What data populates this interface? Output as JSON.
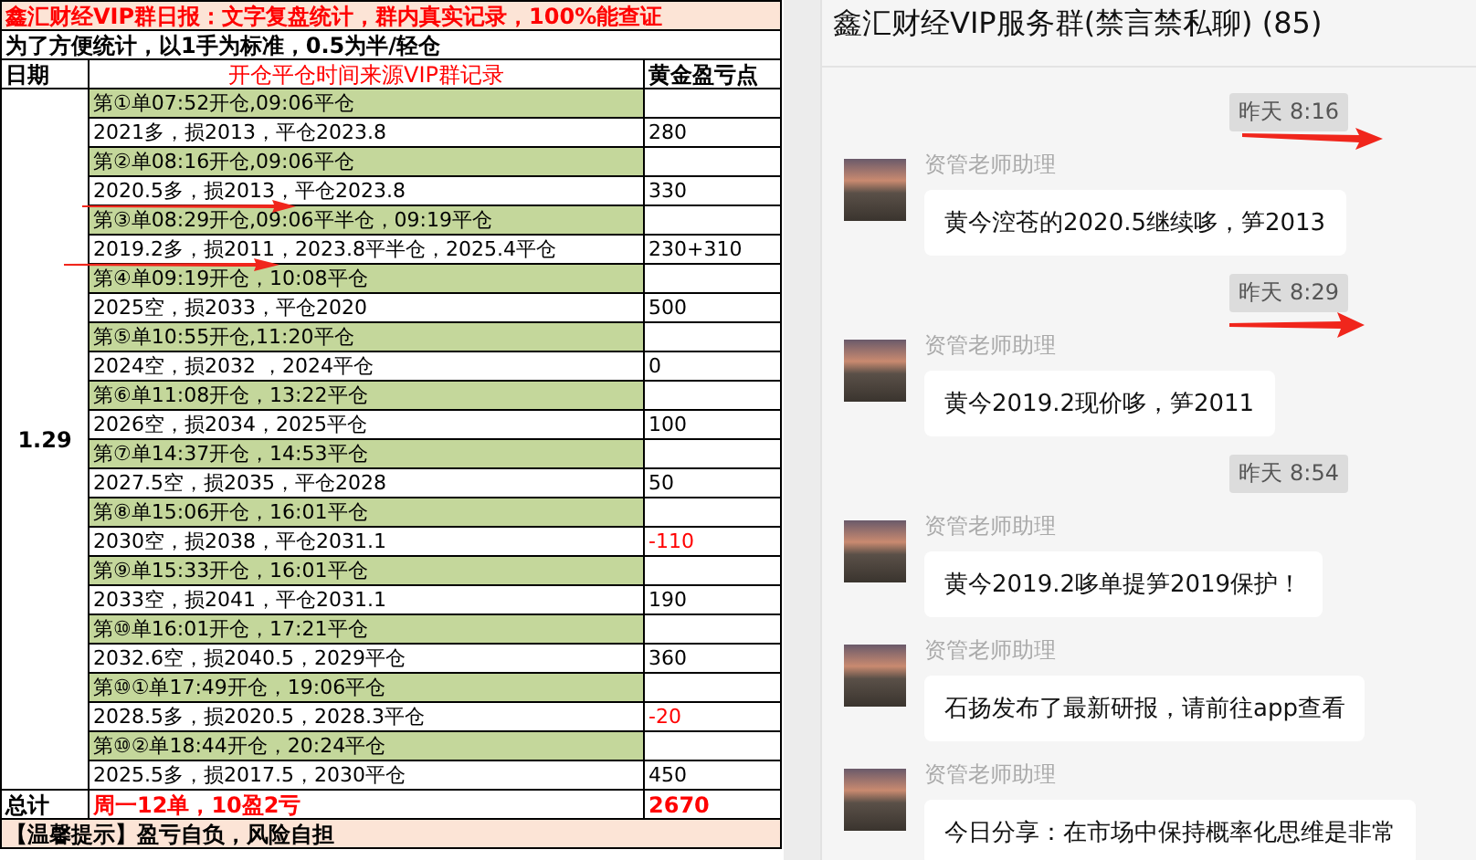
{
  "sheet": {
    "title": "鑫汇财经VIP群日报：文字复盘统计，群内真实记录，100%能查证",
    "note": "为了方便统计，以1手为标准，0.5为半/轻仓",
    "columns": [
      "日期",
      "开仓平仓时间来源VIP群记录",
      "黄金盈亏点"
    ],
    "date": "1.29",
    "orders": [
      {
        "header": "第①单07:52开仓,09:06平仓",
        "detail": "2021多，损2013，平仓2023.8",
        "points": "280",
        "loss": false
      },
      {
        "header": "第②单08:16开仓,09:06平仓",
        "detail": "2020.5多，损2013，平仓2023.8",
        "points": "330",
        "loss": false
      },
      {
        "header": "第③单08:29开仓,09:06平半仓，09:19平仓",
        "detail": "2019.2多，损2011，2023.8平半仓，2025.4平仓",
        "points": "230+310",
        "loss": false
      },
      {
        "header": "第④单09:19开仓，10:08平仓",
        "detail": "2025空，损2033，平仓2020",
        "points": "500",
        "loss": false
      },
      {
        "header": "第⑤单10:55开仓,11:20平仓",
        "detail": "2024空，损2032 ，2024平仓",
        "points": "0",
        "loss": false
      },
      {
        "header": "第⑥单11:08开仓，13:22平仓",
        "detail": "2026空，损2034，2025平仓",
        "points": "100",
        "loss": false
      },
      {
        "header": "第⑦单14:37开仓，14:53平仓",
        "detail": "2027.5空，损2035，平仓2028",
        "points": "50",
        "loss": false
      },
      {
        "header": "第⑧单15:06开仓，16:01平仓",
        "detail": "2030空，损2038，平仓2031.1",
        "points": "-110",
        "loss": true
      },
      {
        "header": "第⑨单15:33开仓，16:01平仓",
        "detail": "2033空，损2041，平仓2031.1",
        "points": "190",
        "loss": false
      },
      {
        "header": "第⑩单16:01开仓，17:21平仓",
        "detail": "2032.6空，损2040.5，2029平仓",
        "points": "360",
        "loss": false
      },
      {
        "header": "第⑩①单17:49开仓，19:06平仓",
        "detail": "2028.5多，损2020.5，2028.3平仓",
        "points": "-20",
        "loss": true
      },
      {
        "header": "第⑩②单18:44开仓，20:24平仓",
        "detail": "2025.5多，损2017.5，2030平仓",
        "points": "450",
        "loss": false
      }
    ],
    "total": {
      "label": "总计",
      "summary": "周一12单，10盈2亏",
      "points": "2670"
    },
    "tip": "【温馨提示】盈亏自负，风险自担"
  },
  "chat": {
    "title": "鑫汇财经VIP服务群(禁言禁私聊) (85)",
    "messages": [
      {
        "kind": "time",
        "text": "昨天 8:16"
      },
      {
        "kind": "message",
        "sender": "资管老师助理",
        "text": "黄今涳苍的2020.5继续哆，笋2013"
      },
      {
        "kind": "time",
        "text": "昨天 8:29"
      },
      {
        "kind": "message",
        "sender": "资管老师助理",
        "text": "黄今2019.2现价哆，笋2011"
      },
      {
        "kind": "time",
        "text": "昨天 8:54"
      },
      {
        "kind": "message",
        "sender": "资管老师助理",
        "text": "黄今2019.2哆单提笋2019保护！"
      },
      {
        "kind": "message",
        "sender": "资管老师助理",
        "text": "石扬发布了最新研报，请前往app查看"
      },
      {
        "kind": "message",
        "sender": "资管老师助理",
        "text": "今日分享：在市场中保持概率化思维是非常"
      }
    ]
  }
}
